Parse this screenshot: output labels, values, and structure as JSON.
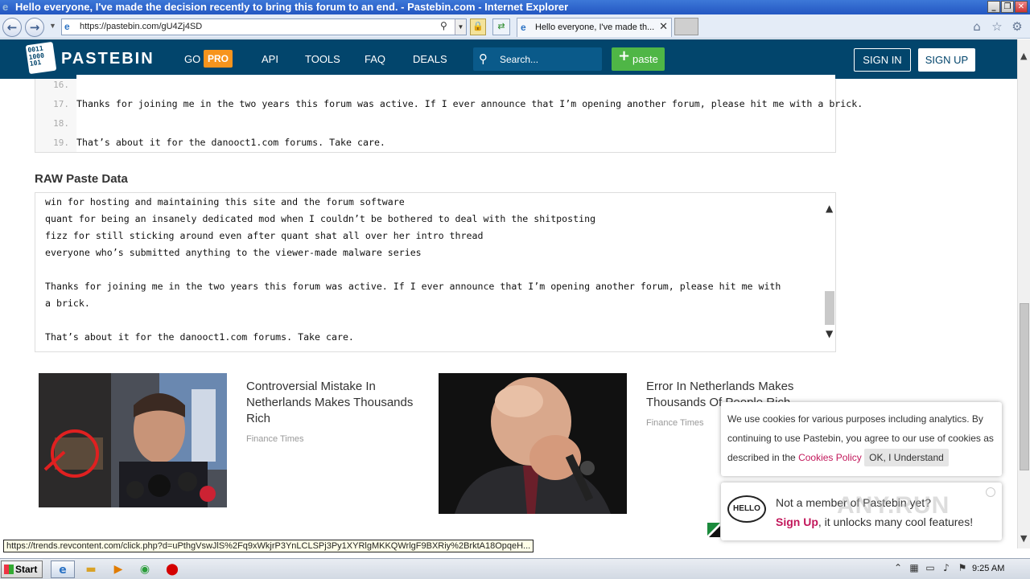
{
  "window": {
    "title": "Hello everyone, I've made the decision recently to bring this forum to an end. - Pastebin.com - Internet Explorer"
  },
  "browser": {
    "url": "https://pastebin.com/gU4Zj4SD",
    "tab_label": "Hello everyone, I've made th...",
    "status_url": "https://trends.revcontent.com/click.php?d=uPthgVswJlS%2Fq9xWkjrP3YnLCLSPj3Py1XYRlgMKKQWrlgF9BXRiy%2BrktA18OpqeH..."
  },
  "header": {
    "logo_text": "PASTEBIN",
    "go_label": "GO",
    "pro_label": "PRO",
    "nav": [
      "API",
      "TOOLS",
      "FAQ",
      "DEALS"
    ],
    "search_placeholder": "Search...",
    "paste_label": "paste",
    "sign_in": "SIGN IN",
    "sign_up": "SIGN UP"
  },
  "code_lines": [
    {
      "num": "16.",
      "text": ""
    },
    {
      "num": "17.",
      "text": "Thanks for joining me in the two years this forum was active. If I ever announce that I’m opening another forum, please hit me with a brick."
    },
    {
      "num": "18.",
      "text": ""
    },
    {
      "num": "19.",
      "text": "That’s about it for the danooct1.com forums. Take care."
    }
  ],
  "raw": {
    "heading": "RAW Paste Data",
    "lines": [
      "win for hosting and maintaining this site and the forum software",
      "quant for being an insanely dedicated mod when I couldn’t be bothered to deal with the shitposting",
      "fizz for still sticking around even after quant shat all over her intro thread",
      "everyone who’s submitted anything to the viewer-made malware series",
      "",
      "Thanks for joining me in the two years this forum was active. If I ever announce that I’m opening another forum, please hit me with",
      "a brick.",
      "",
      "That’s about it for the danooct1.com forums. Take care."
    ]
  },
  "ads": [
    {
      "title_lines": [
        "Controversial Mistake In",
        "Netherlands Makes Thousands",
        "Rich"
      ],
      "source": "Finance Times"
    },
    {
      "title_lines": [
        "Error In Netherlands Makes",
        "Thousands Of People Rich"
      ],
      "source": "Finance Times"
    }
  ],
  "cookie": {
    "text_1": "We use cookies for various purposes including analytics. By continuing to use Pastebin, you agree to our use of cookies as described in the ",
    "link": "Cookies Policy",
    "ok": "OK, I Understand"
  },
  "member": {
    "bubble": "HELLO",
    "question": "Not a member of Pastebin yet?",
    "signup": "Sign Up",
    "rest": ", it unlocks many cool features!"
  },
  "watermark": "ANY.RUN",
  "taskbar": {
    "start": "Start",
    "clock": "9:25 AM"
  }
}
